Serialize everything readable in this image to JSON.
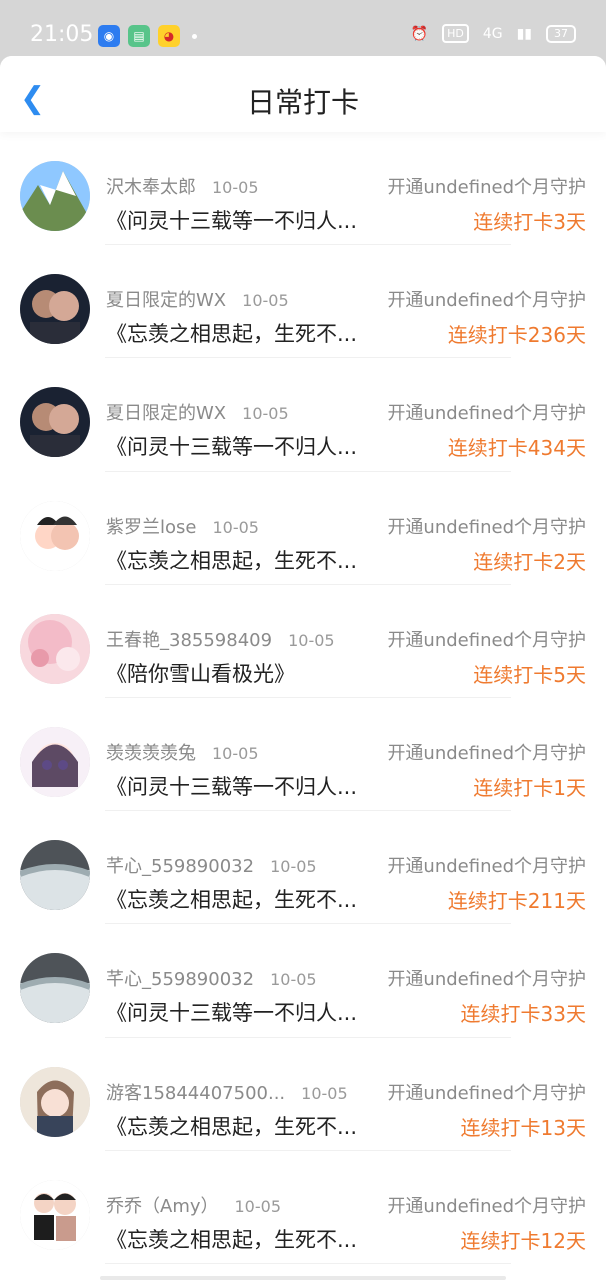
{
  "status": {
    "time": "21:05",
    "battery": "37",
    "hd": "HD",
    "network": "4G",
    "apps": [
      {
        "name": "browser-icon"
      },
      {
        "name": "calendar-app-icon"
      },
      {
        "name": "weibo-icon"
      }
    ]
  },
  "nav": {
    "title": "日常打卡",
    "back_icon": "chevron-left-icon"
  },
  "list": [
    {
      "name": "沢木奉太郎",
      "date": "10-05",
      "guard": "开通undefined个月守护",
      "title": "《问灵十三载等一不归人...",
      "streak": "连续打卡3天"
    },
    {
      "name": "夏日限定的WX",
      "date": "10-05",
      "guard": "开通undefined个月守护",
      "title": "《忘羡之相思起，生死不...",
      "streak": "连续打卡236天"
    },
    {
      "name": "夏日限定的WX",
      "date": "10-05",
      "guard": "开通undefined个月守护",
      "title": "《问灵十三载等一不归人...",
      "streak": "连续打卡434天"
    },
    {
      "name": "紫罗兰lose",
      "date": "10-05",
      "guard": "开通undefined个月守护",
      "title": "《忘羡之相思起，生死不...",
      "streak": "连续打卡2天"
    },
    {
      "name": "王春艳_385598409",
      "date": "10-05",
      "guard": "开通undefined个月守护",
      "title": "《陪你雪山看极光》",
      "streak": "连续打卡5天"
    },
    {
      "name": "羡羡羡羡兔",
      "date": "10-05",
      "guard": "开通undefined个月守护",
      "title": "《问灵十三载等一不归人...",
      "streak": "连续打卡1天"
    },
    {
      "name": "芊心_559890032",
      "date": "10-05",
      "guard": "开通undefined个月守护",
      "title": "《忘羡之相思起，生死不...",
      "streak": "连续打卡211天"
    },
    {
      "name": "芊心_559890032",
      "date": "10-05",
      "guard": "开通undefined个月守护",
      "title": "《问灵十三载等一不归人...",
      "streak": "连续打卡33天"
    },
    {
      "name": "游客15844407500...",
      "date": "10-05",
      "guard": "开通undefined个月守护",
      "title": "《忘羡之相思起，生死不...",
      "streak": "连续打卡13天"
    },
    {
      "name": "乔乔（Amy）",
      "date": "10-05",
      "guard": "开通undefined个月守护",
      "title": "《忘羡之相思起，生死不...",
      "streak": "连续打卡12天"
    }
  ]
}
